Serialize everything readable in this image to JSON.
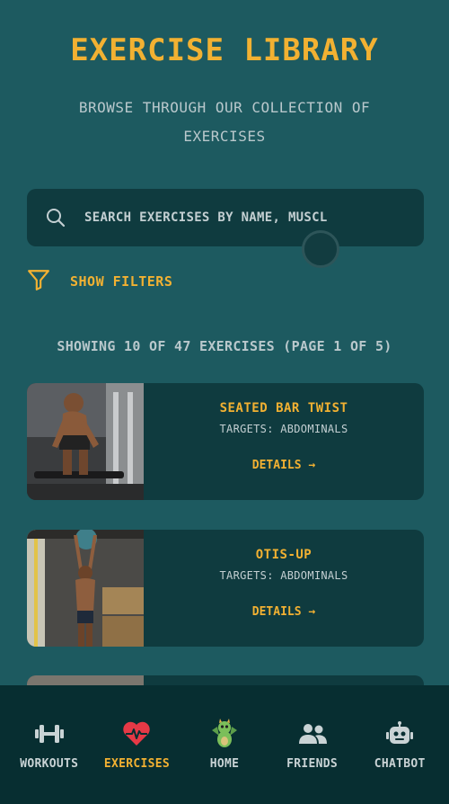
{
  "header": {
    "title": "EXERCISE LIBRARY",
    "subtitle": "BROWSE THROUGH OUR COLLECTION OF EXERCISES"
  },
  "search": {
    "placeholder": "SEARCH EXERCISES BY NAME, MUSCL"
  },
  "filters": {
    "label": "SHOW FILTERS"
  },
  "results": {
    "summary": "SHOWING 10 OF 47 EXERCISES (PAGE 1 OF 5)"
  },
  "exercises": [
    {
      "name": "SEATED BAR TWIST",
      "targets": "TARGETS: ABDOMINALS",
      "details_label": "DETAILS →"
    },
    {
      "name": "OTIS-UP",
      "targets": "TARGETS: ABDOMINALS",
      "details_label": "DETAILS →"
    }
  ],
  "nav": {
    "items": [
      {
        "label": "WORKOUTS",
        "icon": "dumbbell-icon"
      },
      {
        "label": "EXERCISES",
        "icon": "heart-pulse-icon"
      },
      {
        "label": "HOME",
        "icon": "dragon-mascot-icon"
      },
      {
        "label": "FRIENDS",
        "icon": "friends-icon"
      },
      {
        "label": "CHATBOT",
        "icon": "robot-icon"
      }
    ],
    "active": "EXERCISES"
  },
  "colors": {
    "background": "#1d5a60",
    "card": "#0f3b3f",
    "accent": "#f2b132",
    "nav_bg": "#072e31",
    "active_icon": "#e63946"
  }
}
